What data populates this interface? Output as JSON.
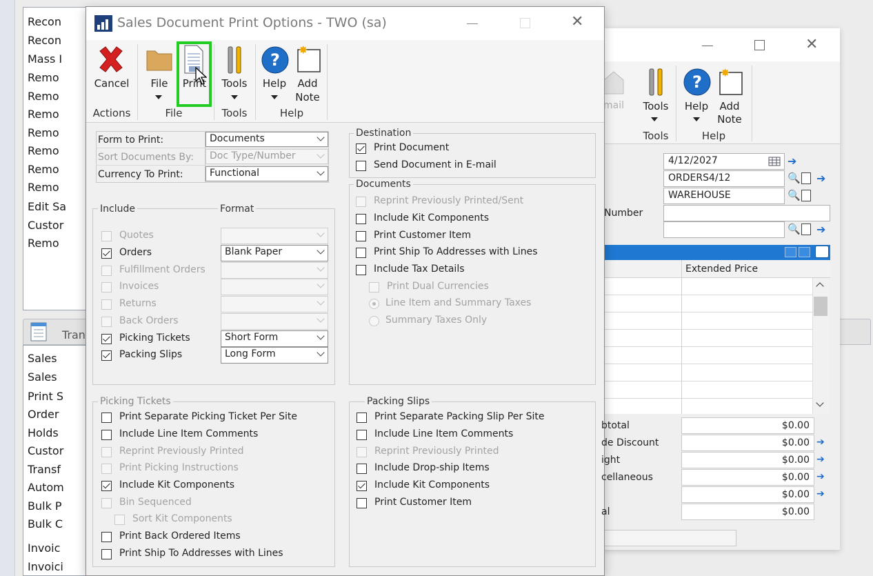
{
  "background": {
    "left_list_top": [
      "Recon",
      "Recon",
      "Mass I",
      "Remo",
      "Remo",
      "Remo",
      "Remo",
      "Remo",
      "Remo",
      "Remo",
      "Edit Sa",
      "Custor",
      "Remo"
    ],
    "left_list_bottom": [
      "Sales",
      "Sales",
      "Print S",
      "Order",
      "Holds",
      "Custor",
      "Transf",
      "Autom",
      "Bulk P",
      "Bulk C",
      "Invoic",
      "Invoici"
    ],
    "transactions_tab": "Tran",
    "sales_window": {
      "ribbon": {
        "email_label": "mail",
        "tools_label": "Tools",
        "tools_group": "Tools",
        "help_label": "Help",
        "add_note_1": "Add",
        "add_note_2": "Note",
        "help_group": "Help"
      },
      "date": "4/12/2027",
      "batch_id": "ORDERS4/12",
      "site": "WAREHOUSE",
      "number_label": "Number",
      "grid_column": "Extended Price",
      "totals": [
        {
          "label": "btotal",
          "value": "$0.00"
        },
        {
          "label": "de Discount",
          "value": "$0.00"
        },
        {
          "label": "ight",
          "value": "$0.00"
        },
        {
          "label": "cellaneous",
          "value": "$0.00"
        },
        {
          "label": "",
          "value": "$0.00"
        },
        {
          "label": "al",
          "value": "$0.00"
        }
      ]
    }
  },
  "dialog": {
    "title": "Sales Document Print Options  -  TWO (sa)",
    "ribbon": {
      "cancel": "Cancel",
      "actions_group": "Actions",
      "file": "File",
      "print": "Print",
      "file_group": "File",
      "tools": "Tools",
      "tools_group": "Tools",
      "help": "Help",
      "add_note_1": "Add",
      "add_note_2": "Note",
      "help_group": "Help"
    },
    "form_to_print_label": "Form to Print:",
    "form_to_print_value": "Documents",
    "sort_by_label": "Sort Documents By:",
    "sort_by_value": "Doc Type/Number",
    "currency_label": "Currency To Print:",
    "currency_value": "Functional",
    "include_label": "Include",
    "format_label": "Format",
    "include_items": [
      {
        "label": "Quotes",
        "checked": false,
        "enabled": false,
        "format": ""
      },
      {
        "label": "Orders",
        "checked": true,
        "enabled": true,
        "format": "Blank Paper"
      },
      {
        "label": "Fulfillment Orders",
        "checked": false,
        "enabled": false,
        "format": ""
      },
      {
        "label": "Invoices",
        "checked": false,
        "enabled": false,
        "format": ""
      },
      {
        "label": "Returns",
        "checked": false,
        "enabled": false,
        "format": ""
      },
      {
        "label": "Back Orders",
        "checked": false,
        "enabled": false,
        "format": ""
      },
      {
        "label": "Picking Tickets",
        "checked": true,
        "enabled": true,
        "format": "Short Form"
      },
      {
        "label": "Packing Slips",
        "checked": true,
        "enabled": true,
        "format": "Long Form"
      }
    ],
    "destination": {
      "title": "Destination",
      "items": [
        {
          "label": "Print Document",
          "checked": true
        },
        {
          "label": "Send Document in E-mail",
          "checked": false
        }
      ]
    },
    "documents": {
      "title": "Documents",
      "items": [
        {
          "label": "Reprint Previously Printed/Sent",
          "checked": false,
          "enabled": false
        },
        {
          "label": "Include Kit Components",
          "checked": false,
          "enabled": true
        },
        {
          "label": "Print Customer Item",
          "checked": false,
          "enabled": true
        },
        {
          "label": "Print Ship To Addresses with Lines",
          "checked": false,
          "enabled": true
        },
        {
          "label": "Include Tax Details",
          "checked": false,
          "enabled": true
        },
        {
          "label": "Print Dual Currencies",
          "checked": false,
          "enabled": false
        }
      ],
      "radios": [
        {
          "label": "Line Item and Summary Taxes",
          "selected": true
        },
        {
          "label": "Summary Taxes Only",
          "selected": false
        }
      ]
    },
    "picking_tickets": {
      "title": "Picking Tickets",
      "items": [
        {
          "label": "Print Separate Picking Ticket Per Site",
          "checked": false,
          "enabled": true
        },
        {
          "label": "Include Line Item Comments",
          "checked": false,
          "enabled": true
        },
        {
          "label": "Reprint Previously Printed",
          "checked": false,
          "enabled": false
        },
        {
          "label": "Print Picking Instructions",
          "checked": false,
          "enabled": false
        },
        {
          "label": "Include Kit Components",
          "checked": true,
          "enabled": true
        },
        {
          "label": "Bin Sequenced",
          "checked": false,
          "enabled": false
        },
        {
          "label": "Sort Kit Components",
          "checked": false,
          "enabled": false
        },
        {
          "label": "Print Back Ordered Items",
          "checked": false,
          "enabled": true
        },
        {
          "label": "Print Ship To Addresses with Lines",
          "checked": false,
          "enabled": true
        }
      ]
    },
    "packing_slips": {
      "title": "Packing Slips",
      "items": [
        {
          "label": "Print Separate Packing Slip Per Site",
          "checked": false,
          "enabled": true
        },
        {
          "label": "Include Line Item Comments",
          "checked": false,
          "enabled": true
        },
        {
          "label": "Reprint Previously Printed",
          "checked": false,
          "enabled": false
        },
        {
          "label": "Include Drop-ship Items",
          "checked": false,
          "enabled": true
        },
        {
          "label": "Include Kit Components",
          "checked": true,
          "enabled": true
        },
        {
          "label": "Print Customer Item",
          "checked": false,
          "enabled": true
        }
      ]
    }
  },
  "colors": {
    "highlight_green": "#22cc22",
    "ribbon_blue": "#1f78d1",
    "cancel_red": "#d42020"
  }
}
